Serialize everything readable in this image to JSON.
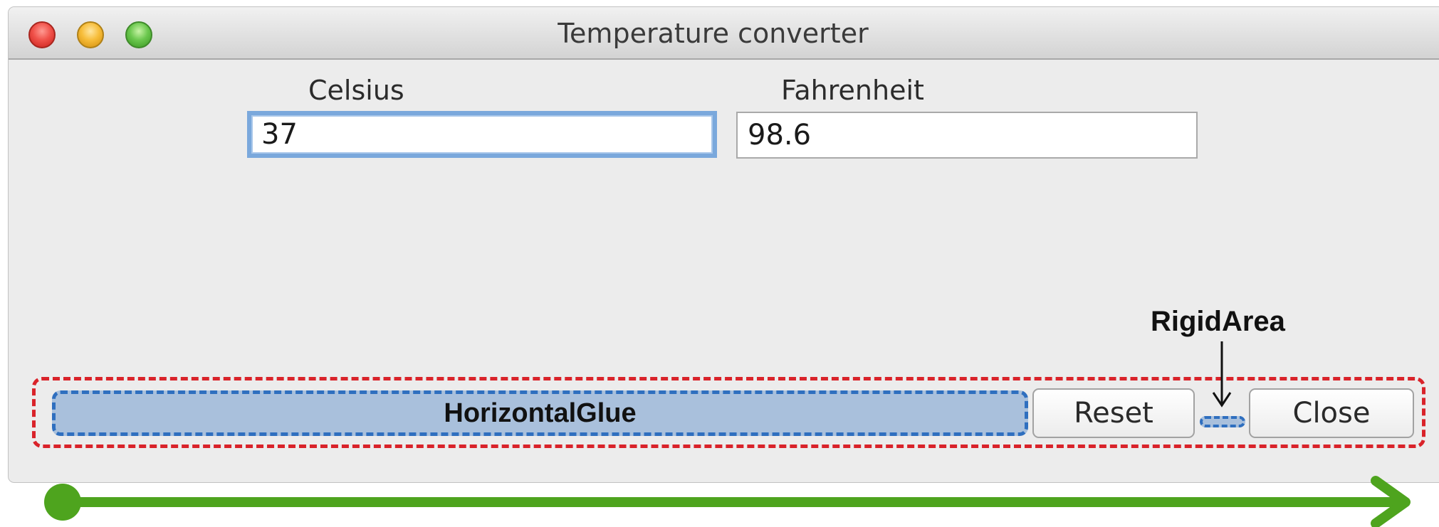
{
  "window": {
    "title": "Temperature converter"
  },
  "form": {
    "celsius_label": "Celsius",
    "celsius_value": "37",
    "fahrenheit_label": "Fahrenheit",
    "fahrenheit_value": "98.6"
  },
  "button_row": {
    "glue_label": "HorizontalGlue",
    "reset_label": "Reset",
    "close_label": "Close",
    "rigid_area_label": "RigidArea"
  },
  "colors": {
    "panel_border": "#d9232a",
    "filler_border": "#2f6fbf",
    "filler_fill": "#a9c0dc",
    "focus_ring": "#7aa8dc",
    "arrow": "#4ea41e"
  }
}
